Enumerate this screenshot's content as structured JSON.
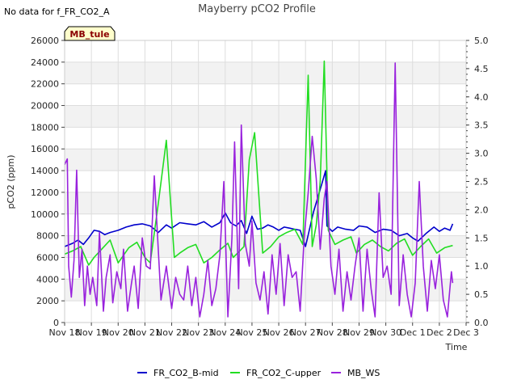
{
  "page": {
    "nodata_text": "No data for f_FR_CO2_A",
    "badge_text": "MB_tule"
  },
  "chart_data": {
    "type": "line",
    "title": "Mayberry pCO2 Profile",
    "xlabel": "Time",
    "ylabel": "pCO2 (ppm)",
    "x_ticks": [
      "Nov 18",
      "Nov 19",
      "Nov 20",
      "Nov 21",
      "Nov 22",
      "Nov 23",
      "Nov 24",
      "Nov 25",
      "Nov 26",
      "Nov 27",
      "Nov 28",
      "Nov 29",
      "Nov 30",
      "Dec 1",
      "Dec 2",
      "Dec 3"
    ],
    "x_range_days": [
      0,
      15
    ],
    "ylim": [
      0,
      26000
    ],
    "y_ticks": [
      0,
      2000,
      4000,
      6000,
      8000,
      10000,
      12000,
      14000,
      16000,
      18000,
      20000,
      22000,
      24000,
      26000
    ],
    "y2lim": [
      0,
      5.0
    ],
    "y2_ticks": [
      "0.0",
      "0.5",
      "1.0",
      "1.5",
      "2.0",
      "2.5",
      "3.0",
      "3.5",
      "4.0",
      "4.5",
      "5.0"
    ],
    "grid": true,
    "legend_position": "bottom",
    "series": [
      {
        "name": "FR_CO2_B-mid",
        "color": "#0000cc",
        "axis": "left",
        "x": [
          0.0,
          0.3,
          0.5,
          0.7,
          0.9,
          1.1,
          1.3,
          1.5,
          1.7,
          2.0,
          2.3,
          2.6,
          2.9,
          3.2,
          3.5,
          3.8,
          4.0,
          4.3,
          4.6,
          4.9,
          5.2,
          5.5,
          5.8,
          6.0,
          6.2,
          6.4,
          6.6,
          6.8,
          7.0,
          7.2,
          7.4,
          7.6,
          7.8,
          8.0,
          8.2,
          8.4,
          8.6,
          8.8,
          9.0,
          9.3,
          9.6,
          9.75,
          9.8,
          10.0,
          10.2,
          10.5,
          10.8,
          11.0,
          11.3,
          11.6,
          11.9,
          12.2,
          12.5,
          12.8,
          13.0,
          13.2,
          13.5,
          13.8,
          14.0,
          14.2,
          14.4,
          14.5
        ],
        "y": [
          7000,
          7300,
          7600,
          7200,
          7800,
          8500,
          8400,
          8100,
          8300,
          8500,
          8800,
          9000,
          9100,
          8900,
          8300,
          9000,
          8700,
          9200,
          9100,
          9000,
          9300,
          8800,
          9200,
          10100,
          9200,
          8900,
          9400,
          8200,
          9800,
          8600,
          8700,
          9000,
          8800,
          8500,
          8800,
          8700,
          8600,
          8500,
          7000,
          10200,
          12700,
          14000,
          8900,
          8400,
          8800,
          8600,
          8500,
          8900,
          8800,
          8300,
          8600,
          8500,
          8000,
          8200,
          7800,
          7500,
          8200,
          8800,
          8400,
          8700,
          8500,
          9100
        ]
      },
      {
        "name": "FR_CO2_C-upper",
        "color": "#22dd22",
        "axis": "left",
        "x": [
          0.0,
          0.3,
          0.6,
          0.9,
          1.1,
          1.4,
          1.7,
          2.0,
          2.2,
          2.4,
          2.7,
          3.0,
          3.2,
          3.5,
          3.8,
          4.1,
          4.3,
          4.6,
          4.9,
          5.2,
          5.5,
          5.8,
          6.1,
          6.3,
          6.5,
          6.7,
          6.9,
          7.1,
          7.4,
          7.7,
          8.0,
          8.3,
          8.6,
          8.9,
          9.1,
          9.25,
          9.4,
          9.55,
          9.7,
          9.85,
          10.1,
          10.4,
          10.7,
          10.9,
          11.2,
          11.5,
          11.8,
          12.1,
          12.4,
          12.7,
          13.0,
          13.3,
          13.6,
          13.9,
          14.2,
          14.5
        ],
        "y": [
          6300,
          6600,
          7000,
          5300,
          6000,
          6800,
          7600,
          5500,
          6200,
          6900,
          7400,
          6000,
          5500,
          11000,
          16800,
          6000,
          6400,
          6900,
          7200,
          5500,
          6000,
          6700,
          7300,
          6000,
          6500,
          7000,
          15000,
          17500,
          6400,
          7000,
          7900,
          8300,
          8600,
          7200,
          22800,
          7000,
          9000,
          13000,
          24100,
          8500,
          7200,
          7600,
          7900,
          6400,
          7200,
          7600,
          7000,
          6600,
          7300,
          7700,
          6200,
          7000,
          7700,
          6400,
          6900,
          7100
        ]
      },
      {
        "name": "MB_WS",
        "color": "#9922dd",
        "axis": "right",
        "x": [
          0.0,
          0.1,
          0.15,
          0.25,
          0.35,
          0.45,
          0.55,
          0.65,
          0.75,
          0.85,
          0.95,
          1.05,
          1.2,
          1.3,
          1.45,
          1.55,
          1.7,
          1.8,
          1.95,
          2.1,
          2.2,
          2.35,
          2.5,
          2.6,
          2.75,
          2.9,
          3.05,
          3.2,
          3.35,
          3.6,
          3.8,
          4.0,
          4.15,
          4.3,
          4.45,
          4.6,
          4.75,
          4.9,
          5.05,
          5.2,
          5.35,
          5.5,
          5.65,
          5.8,
          5.95,
          6.1,
          6.25,
          6.35,
          6.5,
          6.6,
          6.75,
          6.9,
          7.0,
          7.15,
          7.3,
          7.45,
          7.6,
          7.75,
          7.9,
          8.05,
          8.2,
          8.35,
          8.5,
          8.65,
          8.8,
          8.95,
          9.1,
          9.25,
          9.4,
          9.55,
          9.7,
          9.8,
          9.95,
          10.1,
          10.25,
          10.4,
          10.55,
          10.7,
          10.85,
          11.0,
          11.15,
          11.3,
          11.45,
          11.6,
          11.75,
          11.9,
          12.05,
          12.2,
          12.35,
          12.5,
          12.65,
          12.8,
          12.95,
          13.1,
          13.25,
          13.4,
          13.55,
          13.7,
          13.85,
          14.0,
          14.15,
          14.3,
          14.45,
          14.5
        ],
        "y": [
          2.8,
          2.9,
          1.0,
          0.45,
          1.1,
          2.7,
          0.8,
          1.3,
          0.3,
          1.0,
          0.5,
          0.8,
          0.3,
          1.6,
          0.2,
          0.8,
          1.2,
          0.35,
          0.9,
          0.6,
          1.3,
          0.2,
          0.7,
          1.0,
          0.25,
          1.5,
          1.0,
          0.95,
          2.6,
          0.4,
          1.0,
          0.25,
          0.8,
          0.5,
          0.4,
          1.0,
          0.3,
          0.8,
          0.1,
          0.5,
          1.1,
          0.3,
          0.6,
          1.2,
          2.5,
          0.1,
          1.5,
          3.2,
          0.6,
          3.5,
          1.4,
          1.0,
          1.8,
          0.7,
          0.4,
          0.9,
          0.15,
          1.2,
          0.5,
          1.4,
          0.3,
          1.2,
          0.8,
          0.9,
          0.2,
          1.5,
          2.3,
          3.3,
          2.55,
          1.3,
          2.2,
          2.5,
          1.0,
          0.5,
          1.3,
          0.2,
          0.9,
          0.4,
          1.0,
          1.5,
          0.2,
          1.3,
          0.6,
          0.1,
          2.3,
          0.8,
          1.0,
          0.5,
          4.6,
          0.3,
          1.2,
          0.5,
          0.1,
          0.7,
          2.5,
          1.0,
          0.2,
          1.1,
          0.6,
          1.2,
          0.4,
          0.1,
          0.9,
          0.7
        ]
      }
    ]
  }
}
